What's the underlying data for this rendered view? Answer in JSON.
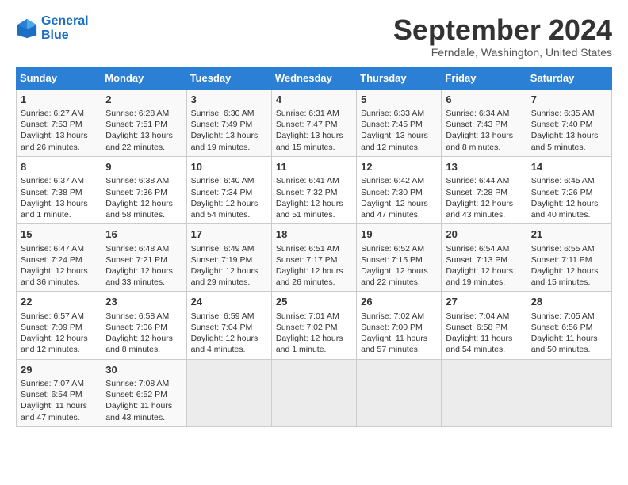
{
  "header": {
    "logo_line1": "General",
    "logo_line2": "Blue",
    "month": "September 2024",
    "location": "Ferndale, Washington, United States"
  },
  "days_of_week": [
    "Sunday",
    "Monday",
    "Tuesday",
    "Wednesday",
    "Thursday",
    "Friday",
    "Saturday"
  ],
  "weeks": [
    [
      {
        "day": "1",
        "info": "Sunrise: 6:27 AM\nSunset: 7:53 PM\nDaylight: 13 hours\nand 26 minutes."
      },
      {
        "day": "2",
        "info": "Sunrise: 6:28 AM\nSunset: 7:51 PM\nDaylight: 13 hours\nand 22 minutes."
      },
      {
        "day": "3",
        "info": "Sunrise: 6:30 AM\nSunset: 7:49 PM\nDaylight: 13 hours\nand 19 minutes."
      },
      {
        "day": "4",
        "info": "Sunrise: 6:31 AM\nSunset: 7:47 PM\nDaylight: 13 hours\nand 15 minutes."
      },
      {
        "day": "5",
        "info": "Sunrise: 6:33 AM\nSunset: 7:45 PM\nDaylight: 13 hours\nand 12 minutes."
      },
      {
        "day": "6",
        "info": "Sunrise: 6:34 AM\nSunset: 7:43 PM\nDaylight: 13 hours\nand 8 minutes."
      },
      {
        "day": "7",
        "info": "Sunrise: 6:35 AM\nSunset: 7:40 PM\nDaylight: 13 hours\nand 5 minutes."
      }
    ],
    [
      {
        "day": "8",
        "info": "Sunrise: 6:37 AM\nSunset: 7:38 PM\nDaylight: 13 hours\nand 1 minute."
      },
      {
        "day": "9",
        "info": "Sunrise: 6:38 AM\nSunset: 7:36 PM\nDaylight: 12 hours\nand 58 minutes."
      },
      {
        "day": "10",
        "info": "Sunrise: 6:40 AM\nSunset: 7:34 PM\nDaylight: 12 hours\nand 54 minutes."
      },
      {
        "day": "11",
        "info": "Sunrise: 6:41 AM\nSunset: 7:32 PM\nDaylight: 12 hours\nand 51 minutes."
      },
      {
        "day": "12",
        "info": "Sunrise: 6:42 AM\nSunset: 7:30 PM\nDaylight: 12 hours\nand 47 minutes."
      },
      {
        "day": "13",
        "info": "Sunrise: 6:44 AM\nSunset: 7:28 PM\nDaylight: 12 hours\nand 43 minutes."
      },
      {
        "day": "14",
        "info": "Sunrise: 6:45 AM\nSunset: 7:26 PM\nDaylight: 12 hours\nand 40 minutes."
      }
    ],
    [
      {
        "day": "15",
        "info": "Sunrise: 6:47 AM\nSunset: 7:24 PM\nDaylight: 12 hours\nand 36 minutes."
      },
      {
        "day": "16",
        "info": "Sunrise: 6:48 AM\nSunset: 7:21 PM\nDaylight: 12 hours\nand 33 minutes."
      },
      {
        "day": "17",
        "info": "Sunrise: 6:49 AM\nSunset: 7:19 PM\nDaylight: 12 hours\nand 29 minutes."
      },
      {
        "day": "18",
        "info": "Sunrise: 6:51 AM\nSunset: 7:17 PM\nDaylight: 12 hours\nand 26 minutes."
      },
      {
        "day": "19",
        "info": "Sunrise: 6:52 AM\nSunset: 7:15 PM\nDaylight: 12 hours\nand 22 minutes."
      },
      {
        "day": "20",
        "info": "Sunrise: 6:54 AM\nSunset: 7:13 PM\nDaylight: 12 hours\nand 19 minutes."
      },
      {
        "day": "21",
        "info": "Sunrise: 6:55 AM\nSunset: 7:11 PM\nDaylight: 12 hours\nand 15 minutes."
      }
    ],
    [
      {
        "day": "22",
        "info": "Sunrise: 6:57 AM\nSunset: 7:09 PM\nDaylight: 12 hours\nand 12 minutes."
      },
      {
        "day": "23",
        "info": "Sunrise: 6:58 AM\nSunset: 7:06 PM\nDaylight: 12 hours\nand 8 minutes."
      },
      {
        "day": "24",
        "info": "Sunrise: 6:59 AM\nSunset: 7:04 PM\nDaylight: 12 hours\nand 4 minutes."
      },
      {
        "day": "25",
        "info": "Sunrise: 7:01 AM\nSunset: 7:02 PM\nDaylight: 12 hours\nand 1 minute."
      },
      {
        "day": "26",
        "info": "Sunrise: 7:02 AM\nSunset: 7:00 PM\nDaylight: 11 hours\nand 57 minutes."
      },
      {
        "day": "27",
        "info": "Sunrise: 7:04 AM\nSunset: 6:58 PM\nDaylight: 11 hours\nand 54 minutes."
      },
      {
        "day": "28",
        "info": "Sunrise: 7:05 AM\nSunset: 6:56 PM\nDaylight: 11 hours\nand 50 minutes."
      }
    ],
    [
      {
        "day": "29",
        "info": "Sunrise: 7:07 AM\nSunset: 6:54 PM\nDaylight: 11 hours\nand 47 minutes."
      },
      {
        "day": "30",
        "info": "Sunrise: 7:08 AM\nSunset: 6:52 PM\nDaylight: 11 hours\nand 43 minutes."
      },
      {
        "day": "",
        "info": ""
      },
      {
        "day": "",
        "info": ""
      },
      {
        "day": "",
        "info": ""
      },
      {
        "day": "",
        "info": ""
      },
      {
        "day": "",
        "info": ""
      }
    ]
  ]
}
